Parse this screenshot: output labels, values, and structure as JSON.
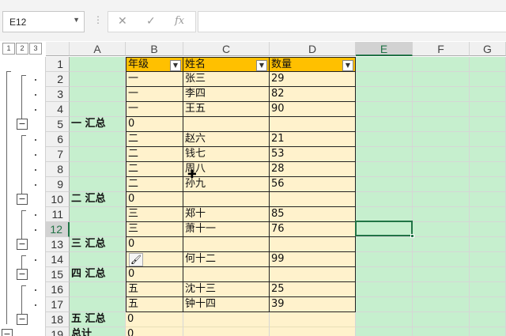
{
  "formula_bar": {
    "name_box": "E12",
    "cancel_icon": "✕",
    "enter_icon": "✓",
    "fx_label": "fx",
    "formula": ""
  },
  "outline_levels": [
    "1",
    "2",
    "3"
  ],
  "columns": [
    "A",
    "B",
    "C",
    "D",
    "E",
    "F",
    "G"
  ],
  "rows": [
    {
      "num": "1",
      "A": "",
      "B": "年级",
      "C": "姓名",
      "D": "数量",
      "type": "header"
    },
    {
      "num": "2",
      "A": "",
      "B": "一",
      "C": "张三",
      "D": "29",
      "type": "data"
    },
    {
      "num": "3",
      "A": "",
      "B": "一",
      "C": "李四",
      "D": "82",
      "type": "data"
    },
    {
      "num": "4",
      "A": "",
      "B": "一",
      "C": "王五",
      "D": "90",
      "type": "data"
    },
    {
      "num": "5",
      "A": "一 汇总",
      "B": "0",
      "C": "",
      "D": "",
      "type": "sum"
    },
    {
      "num": "6",
      "A": "",
      "B": "二",
      "C": "赵六",
      "D": "21",
      "type": "data"
    },
    {
      "num": "7",
      "A": "",
      "B": "二",
      "C": "钱七",
      "D": "53",
      "type": "data"
    },
    {
      "num": "8",
      "A": "",
      "B": "二",
      "C": "周八",
      "D": "28",
      "type": "data"
    },
    {
      "num": "9",
      "A": "",
      "B": "二",
      "C": "孙九",
      "D": "56",
      "type": "data"
    },
    {
      "num": "10",
      "A": "二 汇总",
      "B": "0",
      "C": "",
      "D": "",
      "type": "sum"
    },
    {
      "num": "11",
      "A": "",
      "B": "三",
      "C": "郑十",
      "D": "85",
      "type": "data"
    },
    {
      "num": "12",
      "A": "",
      "B": "三",
      "C": "萧十一",
      "D": "76",
      "type": "data"
    },
    {
      "num": "13",
      "A": "三 汇总",
      "B": "0",
      "C": "",
      "D": "",
      "type": "sum"
    },
    {
      "num": "14",
      "A": "",
      "B": "",
      "C": "何十二",
      "D": "99",
      "type": "data"
    },
    {
      "num": "15",
      "A": "四 汇总",
      "B": "0",
      "C": "",
      "D": "",
      "type": "sum"
    },
    {
      "num": "16",
      "A": "",
      "B": "五",
      "C": "沈十三",
      "D": "25",
      "type": "data"
    },
    {
      "num": "17",
      "A": "",
      "B": "五",
      "C": "钟十四",
      "D": "39",
      "type": "data"
    },
    {
      "num": "18",
      "A": "五 汇总",
      "B": "0",
      "C": "",
      "D": "",
      "type": "last"
    },
    {
      "num": "19",
      "A": "总计",
      "B": "0",
      "C": "",
      "D": "",
      "type": "last"
    }
  ],
  "colors": {
    "green_fill": "#c6efce",
    "header_fill": "#ffc000",
    "data_fill": "#fff2cc",
    "selection": "#217346"
  },
  "icons": {
    "filter": "filter-dropdown-icon",
    "paste_options": "paste-options-icon",
    "cursor": "cell-select-cursor-icon"
  }
}
